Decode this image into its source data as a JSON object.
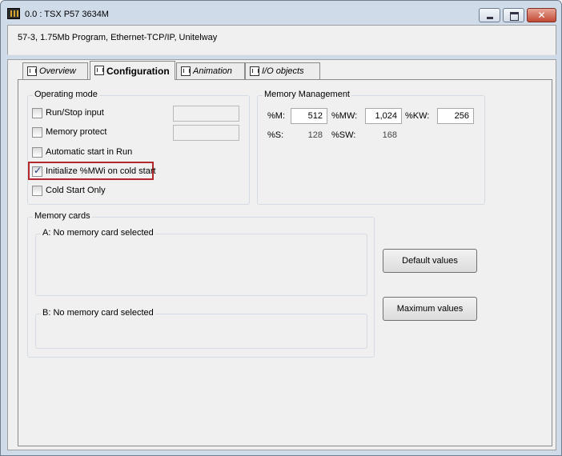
{
  "window": {
    "title": "0.0 : TSX P57 3634M",
    "close_glyph": "✕",
    "description": "57-3, 1.75Mb Program, Ethernet-TCP/IP, Unitelway"
  },
  "tabs": [
    {
      "label": "Overview",
      "active": false
    },
    {
      "label": "Configuration",
      "active": true
    },
    {
      "label": "Animation",
      "active": false
    },
    {
      "label": "I/O objects",
      "active": false
    }
  ],
  "operating_mode": {
    "title": "Operating mode",
    "options": [
      {
        "label": "Run/Stop input",
        "checked": false
      },
      {
        "label": "Memory protect",
        "checked": false
      },
      {
        "label": "Automatic start in Run",
        "checked": false
      },
      {
        "label": "Initialize %MWi on cold start",
        "checked": true
      },
      {
        "label": "Cold Start Only",
        "checked": false
      }
    ]
  },
  "memory_management": {
    "title": "Memory Management",
    "m_label": "%M:",
    "m_value": "512",
    "mw_label": "%MW:",
    "mw_value": "1,024",
    "kw_label": "%KW:",
    "kw_value": "256",
    "s_label": "%S:",
    "s_value": "128",
    "sw_label": "%SW:",
    "sw_value": "168"
  },
  "memory_cards": {
    "title": "Memory cards",
    "card_a": "A: No memory card selected",
    "card_b": "B: No memory card selected"
  },
  "buttons": {
    "default_values": "Default values",
    "maximum_values": "Maximum values"
  },
  "colors": {
    "highlight": "#b2282b",
    "window_frame": "#cfdbe8"
  }
}
